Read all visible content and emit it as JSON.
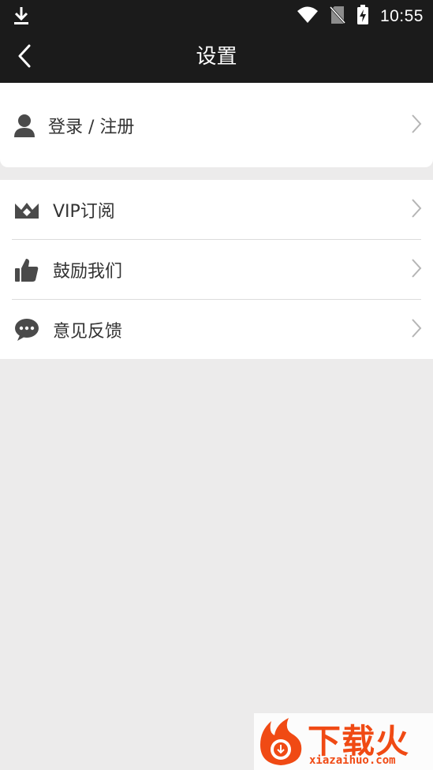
{
  "status": {
    "time": "10:55",
    "icons": [
      "download-icon",
      "wifi-icon",
      "no-sim-icon",
      "battery-charging-icon"
    ]
  },
  "header": {
    "title": "设置",
    "back_icon": "chevron-left-icon"
  },
  "login": {
    "label": "登录 / 注册",
    "icon": "user-icon"
  },
  "menu": [
    {
      "label": "VIP订阅",
      "icon": "crown-icon"
    },
    {
      "label": "鼓励我们",
      "icon": "thumbs-up-icon"
    },
    {
      "label": "意见反馈",
      "icon": "chat-bubble-icon"
    }
  ],
  "watermark": {
    "title": "下载火",
    "url": "xiazaihuo.com"
  },
  "colors": {
    "bar": "#1b1b1b",
    "background": "#ecebeb",
    "icon": "#4a4a4a",
    "chevron": "#b5b5b5",
    "watermark": "#f04a14"
  }
}
